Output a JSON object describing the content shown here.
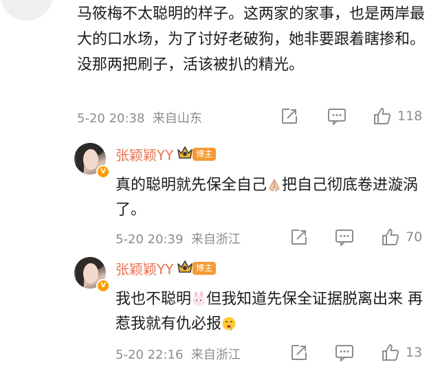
{
  "main_comment": {
    "text_before_end": "马筱梅不太聪明的样子。这两家的家事，也是两岸最大的口水场，为了讨好老破狗，她非要跟着瞎掺和。没那两把刷子，活该被扒的精光。",
    "time": "5-20 20:38",
    "source": "来自山东",
    "likes": "118"
  },
  "replies": [
    {
      "username": "张颖颖YY",
      "badge": "博主",
      "text_part1": "真的聪明就先保全自己",
      "emoji1": "praying-hands-emoji",
      "text_part2": "把自己彻底卷进漩涡了。",
      "time": "5-20 20:39",
      "source": "来自浙江",
      "likes": "70"
    },
    {
      "username": "张颖颖YY",
      "badge": "博主",
      "text_part1": "我也不聪明",
      "emoji1": "bunny-emoji",
      "text_part2": "但我知道先保全证据脱离出来 再惹我就有仇必报",
      "emoji2": "drooling-face-emoji",
      "time": "5-20 22:16",
      "source": "来自浙江",
      "likes": "13"
    }
  ],
  "colors": {
    "username": "#eb7350",
    "meta": "#8c8c8c",
    "badge": "#f59a34",
    "verified": "#ff9d00"
  },
  "icons": [
    "share-icon",
    "comment-icon",
    "like-icon",
    "crown-icon"
  ]
}
